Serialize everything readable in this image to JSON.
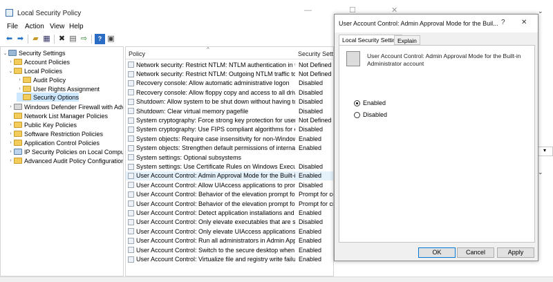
{
  "window": {
    "title": "Local Security Policy"
  },
  "menu": [
    "File",
    "Action",
    "View",
    "Help"
  ],
  "toolbar": {
    "icons": [
      "back-arrow-icon",
      "forward-arrow-icon",
      "up-folder-icon",
      "show-tree-icon",
      "delete-icon",
      "properties-icon",
      "export-icon",
      "help-icon",
      "console-icon"
    ]
  },
  "tree": {
    "items": [
      {
        "label": "Security Settings",
        "level": 0,
        "expanded": true
      },
      {
        "label": "Account Policies",
        "level": 1,
        "expanded": false
      },
      {
        "label": "Local Policies",
        "level": 1,
        "expanded": true
      },
      {
        "label": "Audit Policy",
        "level": 2,
        "expanded": false
      },
      {
        "label": "User Rights Assignment",
        "level": 2,
        "expanded": false
      },
      {
        "label": "Security Options",
        "level": 2,
        "selected": true
      },
      {
        "label": "Windows Defender Firewall with Adva",
        "level": 1,
        "expanded": false
      },
      {
        "label": "Network List Manager Policies",
        "level": 1
      },
      {
        "label": "Public Key Policies",
        "level": 1,
        "expanded": false
      },
      {
        "label": "Software Restriction Policies",
        "level": 1,
        "expanded": false
      },
      {
        "label": "Application Control Policies",
        "level": 1,
        "expanded": false
      },
      {
        "label": "IP Security Policies on Local Compute",
        "level": 1,
        "expanded": false
      },
      {
        "label": "Advanced Audit Policy Configuration",
        "level": 1,
        "expanded": false
      }
    ]
  },
  "list": {
    "columns": {
      "policy": "Policy",
      "setting": "Security Settin"
    },
    "rows": [
      {
        "policy": "Network security: Restrict NTLM: NTLM authentication in th...",
        "setting": "Not Defined"
      },
      {
        "policy": "Network security: Restrict NTLM: Outgoing NTLM traffic to ...",
        "setting": "Not Defined"
      },
      {
        "policy": "Recovery console: Allow automatic administrative logon",
        "setting": "Disabled"
      },
      {
        "policy": "Recovery console: Allow floppy copy and access to all drives...",
        "setting": "Disabled"
      },
      {
        "policy": "Shutdown: Allow system to be shut down without having to...",
        "setting": "Disabled"
      },
      {
        "policy": "Shutdown: Clear virtual memory pagefile",
        "setting": "Disabled"
      },
      {
        "policy": "System cryptography: Force strong key protection for user k...",
        "setting": "Not Defined"
      },
      {
        "policy": "System cryptography: Use FIPS compliant algorithms for en...",
        "setting": "Disabled"
      },
      {
        "policy": "System objects: Require case insensitivity for non-Windows ...",
        "setting": "Enabled"
      },
      {
        "policy": "System objects: Strengthen default permissions of internal s...",
        "setting": "Enabled"
      },
      {
        "policy": "System settings: Optional subsystems",
        "setting": ""
      },
      {
        "policy": "System settings: Use Certificate Rules on Windows Executabl...",
        "setting": "Disabled"
      },
      {
        "policy": "User Account Control: Admin Approval Mode for the Built-i...",
        "setting": "Enabled",
        "selected": true
      },
      {
        "policy": "User Account Control: Allow UIAccess applications to prom...",
        "setting": "Disabled"
      },
      {
        "policy": "User Account Control: Behavior of the elevation prompt for ...",
        "setting": "Prompt for co"
      },
      {
        "policy": "User Account Control: Behavior of the elevation prompt for ...",
        "setting": "Prompt for cre"
      },
      {
        "policy": "User Account Control: Detect application installations and p...",
        "setting": "Enabled"
      },
      {
        "policy": "User Account Control: Only elevate executables that are sign...",
        "setting": "Disabled"
      },
      {
        "policy": "User Account Control: Only elevate UIAccess applications th...",
        "setting": "Enabled"
      },
      {
        "policy": "User Account Control: Run all administrators in Admin Appr...",
        "setting": "Enabled"
      },
      {
        "policy": "User Account Control: Switch to the secure desktop when pr...",
        "setting": "Enabled"
      },
      {
        "policy": "User Account Control: Virtualize file and registry write failure...",
        "setting": "Enabled"
      }
    ]
  },
  "dialog": {
    "title": "User Account Control: Admin Approval Mode for the Buil...",
    "help_glyph": "?",
    "close_glyph": "✕",
    "tabs": [
      "Local Security Setting",
      "Explain"
    ],
    "policy_name": "User Account Control: Admin Approval Mode for the Built-in Administrator account",
    "options": [
      {
        "label": "Enabled",
        "checked": true
      },
      {
        "label": "Disabled",
        "checked": false
      }
    ],
    "buttons": {
      "ok": "OK",
      "cancel": "Cancel",
      "apply": "Apply"
    }
  },
  "main_controls": {
    "minimize": "—",
    "maximize": "☐",
    "close": "✕"
  }
}
